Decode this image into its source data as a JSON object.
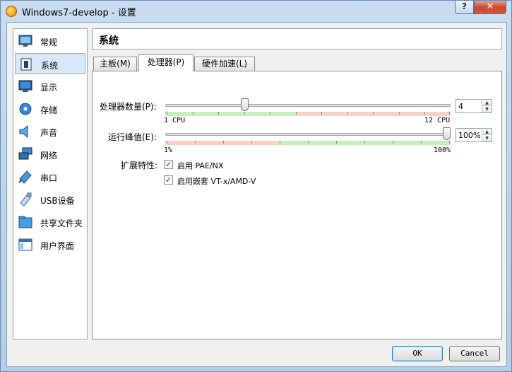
{
  "window": {
    "title": "Windows7-develop - 设置",
    "help_label": "?",
    "close_label": "✕"
  },
  "sidebar": {
    "items": [
      {
        "label": "常规",
        "icon": "monitor-icon"
      },
      {
        "label": "系统",
        "icon": "chip-icon"
      },
      {
        "label": "显示",
        "icon": "display-icon"
      },
      {
        "label": "存储",
        "icon": "disk-icon"
      },
      {
        "label": "声音",
        "icon": "speaker-icon"
      },
      {
        "label": "网络",
        "icon": "network-icon"
      },
      {
        "label": "串口",
        "icon": "serial-port-icon"
      },
      {
        "label": "USB设备",
        "icon": "usb-icon"
      },
      {
        "label": "共享文件夹",
        "icon": "folder-icon"
      },
      {
        "label": "用户界面",
        "icon": "ui-window-icon"
      }
    ],
    "selected_index": 1
  },
  "page": {
    "title": "系统"
  },
  "tabs": [
    {
      "label": "主板(M)",
      "active": false
    },
    {
      "label": "处理器(P)",
      "active": true
    },
    {
      "label": "硬件加速(L)",
      "active": false
    }
  ],
  "processor": {
    "count_label": "处理器数量(P):",
    "count_value": "4",
    "count_min_label": "1 CPU",
    "count_max_label": "12 CPU",
    "count_slider": {
      "value": 4,
      "min": 1,
      "max": 12
    },
    "cap_label": "运行峰值(E):",
    "cap_value": "100%",
    "cap_min_label": "1%",
    "cap_max_label": "100%",
    "cap_slider": {
      "value": 100,
      "min": 1,
      "max": 100
    },
    "features_label": "扩展特性:",
    "pae_label": "启用 PAE/NX",
    "pae_checked": true,
    "nested_label": "启用嵌套 VT-x/AMD-V",
    "nested_checked": true
  },
  "buttons": {
    "ok": "OK",
    "cancel": "Cancel"
  },
  "colors": {
    "good_zone": "#c3f0b8",
    "warn_zone": "#f7d2c1",
    "selection": "#d9e8f7"
  }
}
